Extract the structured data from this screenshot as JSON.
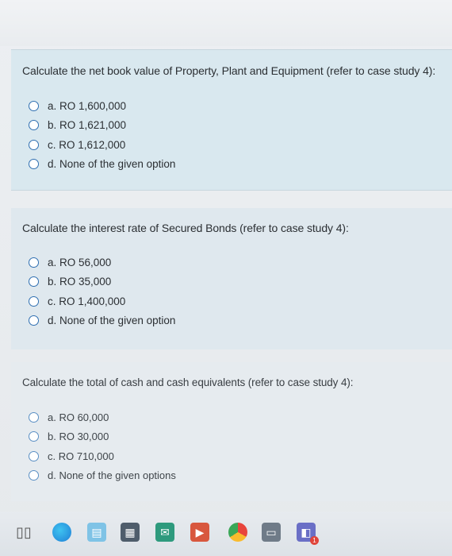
{
  "questions": [
    {
      "text": "Calculate the net book value of Property, Plant and Equipment (refer to case study 4):",
      "options": [
        "a. RO 1,600,000",
        "b. RO 1,621,000",
        "c. RO 1,612,000",
        "d. None of the given option"
      ]
    },
    {
      "text": "Calculate the interest rate of Secured Bonds (refer to case study 4):",
      "options": [
        "a. RO 56,000",
        "b. RO 35,000",
        "c. RO 1,400,000",
        "d. None of the given option"
      ]
    },
    {
      "text": "Calculate the total of cash and cash equivalents (refer to case study 4):",
      "options": [
        "a. RO 60,000",
        "b. RO 30,000",
        "c. RO 710,000",
        "d. None of the given options"
      ]
    }
  ],
  "taskbar": {
    "icons": [
      "task-view-icon",
      "edge-icon",
      "store-icon",
      "calculator-icon",
      "mail-icon",
      "powerpoint-icon",
      "chrome-icon",
      "file-explorer-icon",
      "teams-icon"
    ],
    "teams_badge": "1"
  },
  "colors": {
    "card_1_bg": "#d9e8ef",
    "radio_border": "#2f6fb1",
    "text": "#2b2f33"
  }
}
